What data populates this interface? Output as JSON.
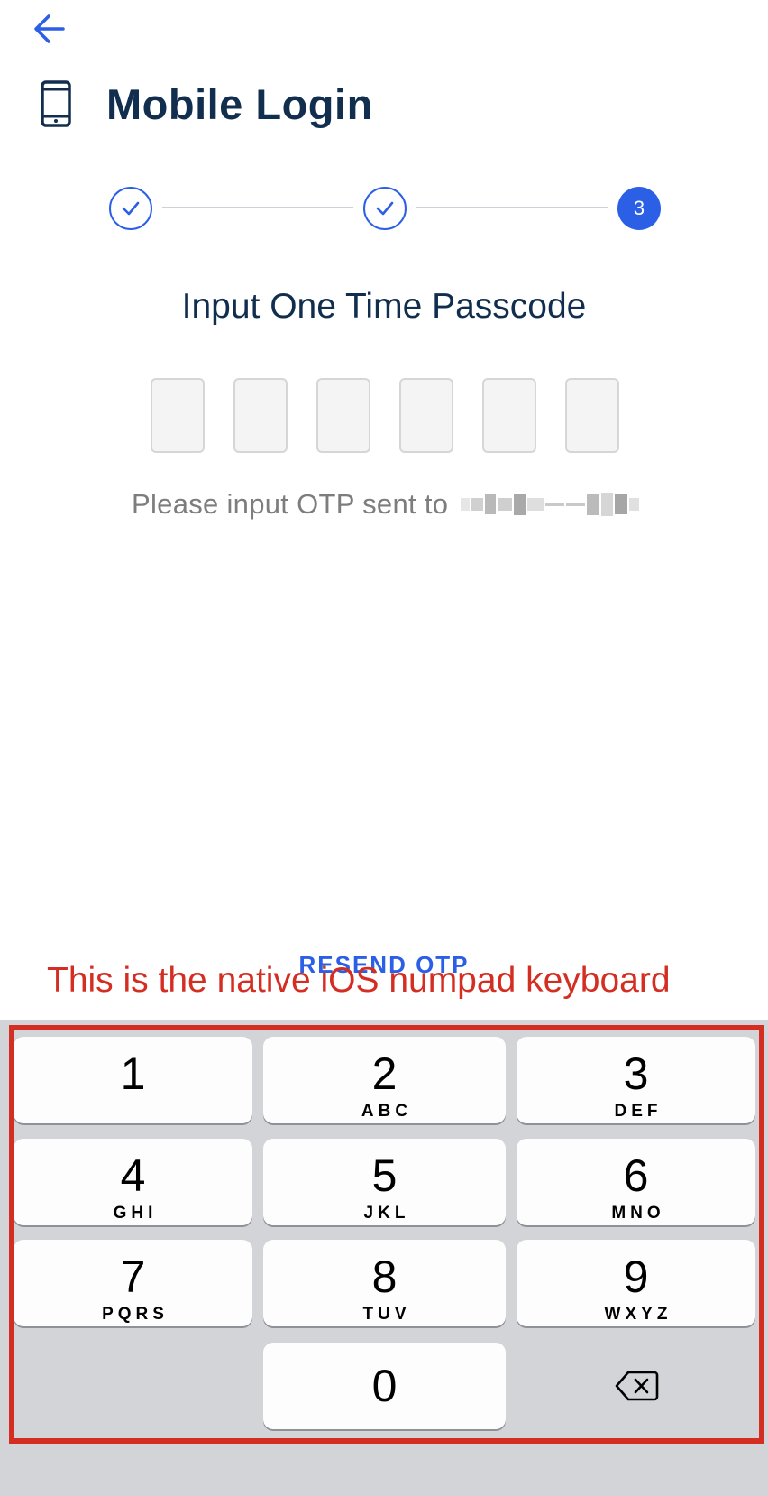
{
  "header": {
    "back_icon": "back-arrow-icon",
    "title_icon": "mobile-phone-icon",
    "title": "Mobile Login"
  },
  "stepper": {
    "steps": [
      {
        "state": "done",
        "icon": "checkmark-icon"
      },
      {
        "state": "done",
        "icon": "checkmark-icon"
      },
      {
        "state": "active",
        "label": "3"
      }
    ],
    "accent_color": "#2b5fe6"
  },
  "otp": {
    "title": "Input One Time Passcode",
    "box_count": 6,
    "hint": "Please input OTP sent to",
    "masked_number_icon": "pixelated-redaction"
  },
  "resend_label": "RESEND OTP",
  "annotation": {
    "text": "This is the native iOS numpad keyboard",
    "color": "#d42e22"
  },
  "keyboard": {
    "keys": [
      {
        "digit": "1",
        "letters": ""
      },
      {
        "digit": "2",
        "letters": "ABC"
      },
      {
        "digit": "3",
        "letters": "DEF"
      },
      {
        "digit": "4",
        "letters": "GHI"
      },
      {
        "digit": "5",
        "letters": "JKL"
      },
      {
        "digit": "6",
        "letters": "MNO"
      },
      {
        "digit": "7",
        "letters": "PQRS"
      },
      {
        "digit": "8",
        "letters": "TUV"
      },
      {
        "digit": "9",
        "letters": "WXYZ"
      },
      {
        "digit": "0",
        "letters": ""
      }
    ],
    "delete_icon": "backspace-icon"
  }
}
